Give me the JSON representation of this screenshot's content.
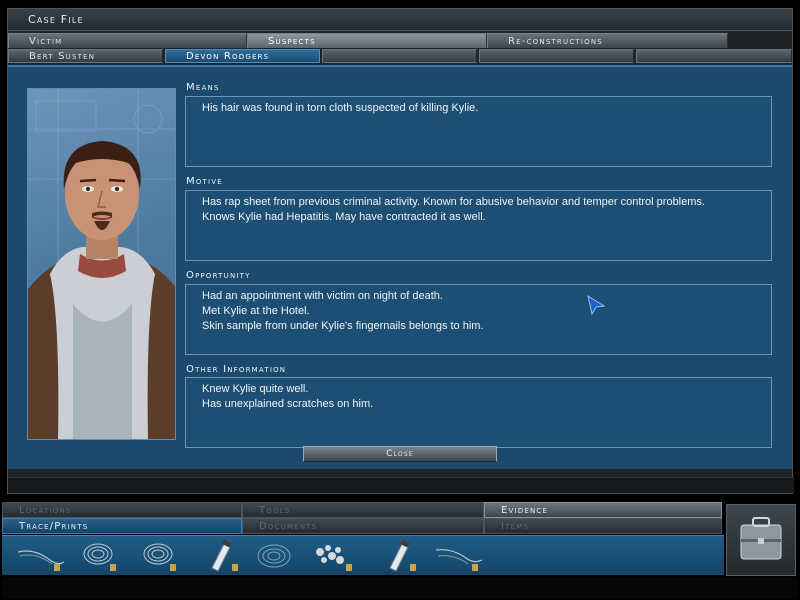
{
  "window": {
    "title": "Case File"
  },
  "tabs": [
    "Victim",
    "Suspects",
    "Re-constructions"
  ],
  "suspect_tabs": [
    "Bert Susten",
    "Devon Rodgers",
    "",
    "",
    ""
  ],
  "sections": {
    "means": {
      "label": "Means",
      "lines": [
        "His hair was found in torn cloth suspected of killing Kylie."
      ]
    },
    "motive": {
      "label": "Motive",
      "lines": [
        "Has rap sheet from previous criminal activity. Known for abusive behavior and temper control problems.",
        "Knows Kylie had Hepatitis. May have contracted it as well."
      ]
    },
    "opportunity": {
      "label": "Opportunity",
      "lines": [
        "Had an appointment with victim on night of death.",
        "Met Kylie at the Hotel.",
        "Skin sample from under Kylie's fingernails belongs to him."
      ]
    },
    "other": {
      "label": "Other Information",
      "lines": [
        "Knew Kylie quite well.",
        "Has unexplained scratches on him."
      ]
    }
  },
  "close_label": "Close",
  "inventory": {
    "tabs_row1": [
      "Locations",
      "Tools",
      "Evidence"
    ],
    "tabs_row2": [
      "Trace/Prints",
      "Documents",
      "Items"
    ],
    "items": [
      "hair-fiber-icon",
      "fingerprint-icon",
      "fingerprint-icon",
      "vial-icon",
      "fingerprint-icon",
      "debris-icon",
      "vial-icon",
      "hair-fiber-icon"
    ]
  },
  "colors": {
    "panel": "#1b4a6e",
    "accent": "#3c7eae",
    "text": "#f0f3f5"
  }
}
